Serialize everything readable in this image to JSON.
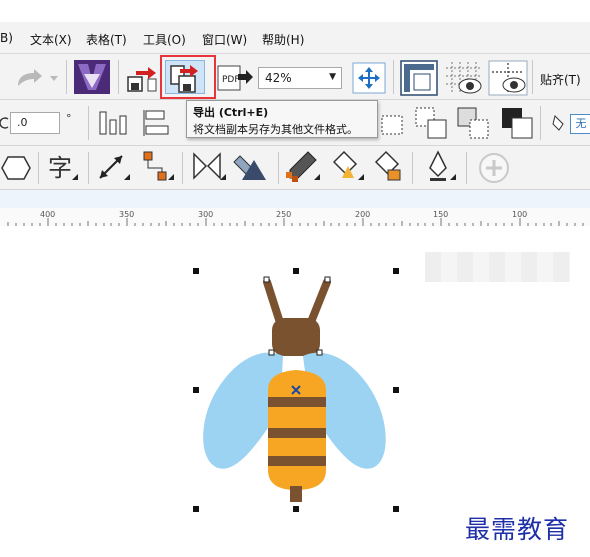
{
  "menubar": {
    "items": [
      "B)",
      "文本(X)",
      "表格(T)",
      "工具(O)",
      "窗口(W)",
      "帮助(H)"
    ]
  },
  "toolbar": {
    "zoom_value": "42%",
    "snap_label": "贴齐(T)",
    "angle_value": ".0",
    "angle_unit": "°",
    "fill_label": "无"
  },
  "tooltip": {
    "title": "导出 (Ctrl+E)",
    "description": "将文档副本另存为其他文件格式。"
  },
  "ruler": {
    "labels": [
      "400",
      "350",
      "300",
      "250",
      "200",
      "150",
      "100"
    ]
  },
  "colors": {
    "accent_highlight": "#e8343b",
    "bee_body": "#f6a623",
    "bee_stripes": "#7a5230",
    "bee_wings": "#9dd3f2",
    "watermark": "#1f2fa8"
  },
  "watermark": "最需教育"
}
